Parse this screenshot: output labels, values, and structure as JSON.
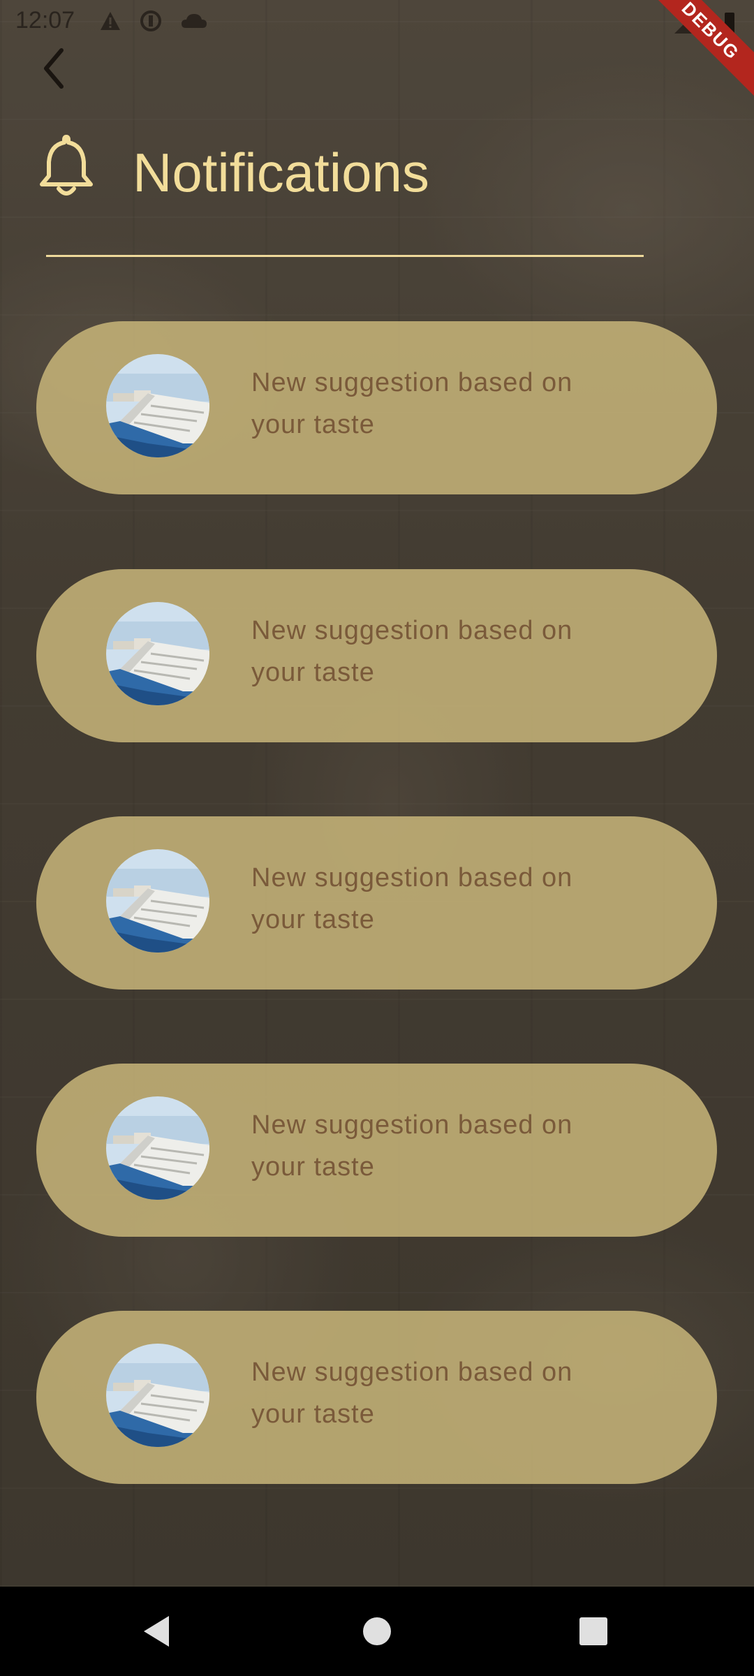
{
  "status_bar": {
    "time": "12:07",
    "debug_label": "DEBUG"
  },
  "header": {
    "title": "Notifications"
  },
  "notifications": [
    {
      "text": "New suggestion based on your taste"
    },
    {
      "text": "New suggestion based on your taste"
    },
    {
      "text": "New suggestion based on your taste"
    },
    {
      "text": "New suggestion based on your taste"
    },
    {
      "text": "New suggestion based on your taste"
    }
  ],
  "colors": {
    "title": "#f2dd9a",
    "card_background": "#c4b278",
    "card_text": "#7a5a3a",
    "divider": "#eed99b"
  },
  "icons": {
    "back": "chevron-left-icon",
    "header": "bell-icon",
    "nav_back": "triangle-back-icon",
    "nav_home": "circle-home-icon",
    "nav_recents": "square-recents-icon"
  }
}
